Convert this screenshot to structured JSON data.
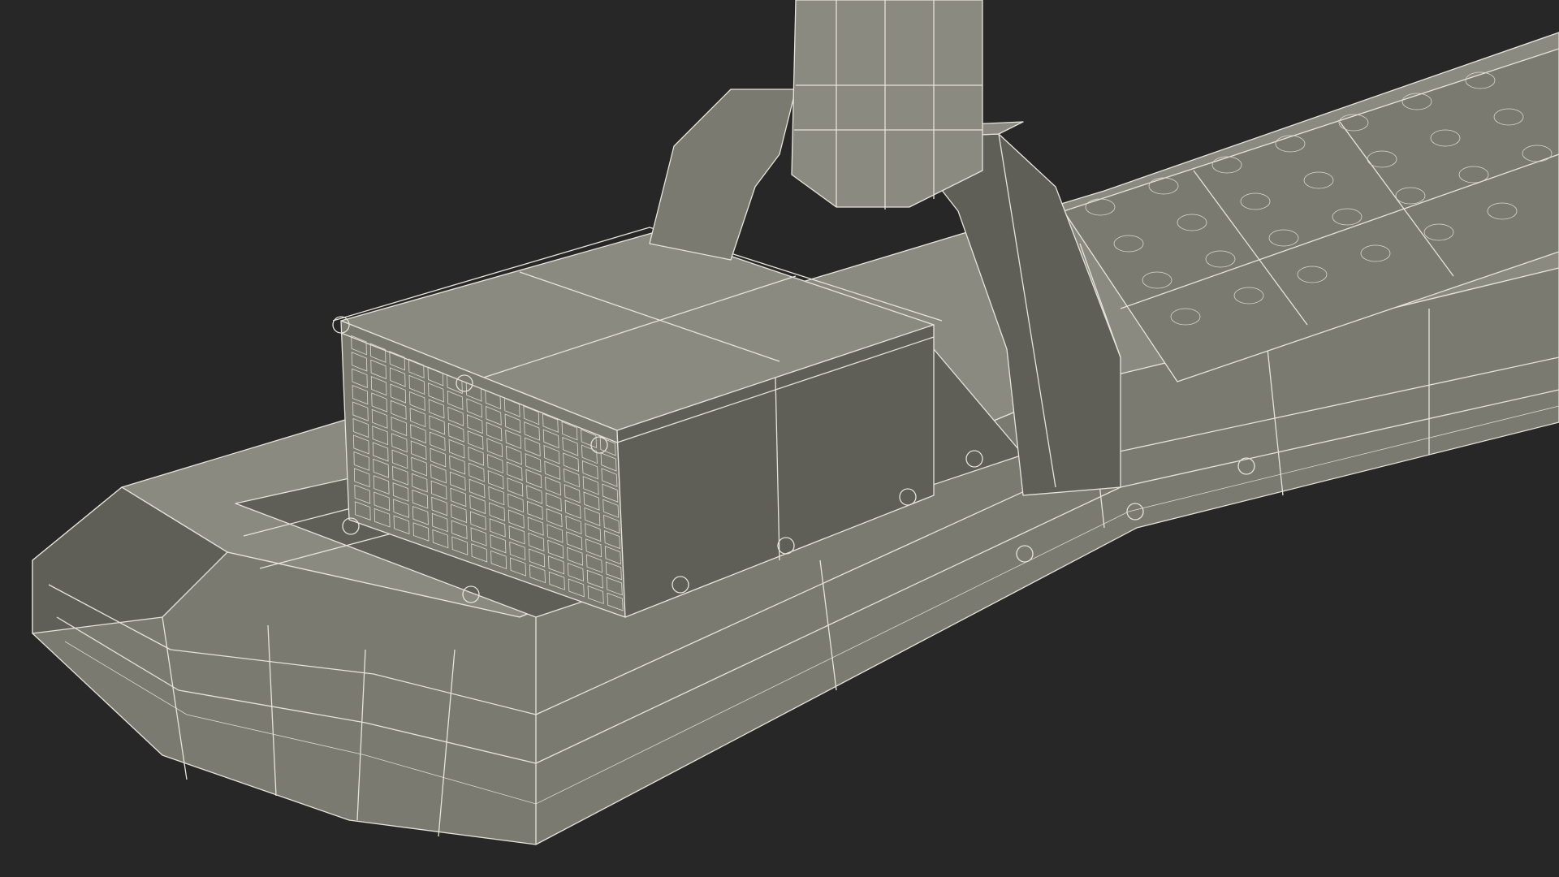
{
  "viewport": {
    "background_color": "#272727",
    "surface_color": "#7a7a70",
    "surface_shadow_color": "#5f5f57",
    "surface_light_color": "#8a8a80",
    "wire_color": "#e6e4da"
  },
  "icons": {
    "render": "wireframe-model-icon"
  }
}
